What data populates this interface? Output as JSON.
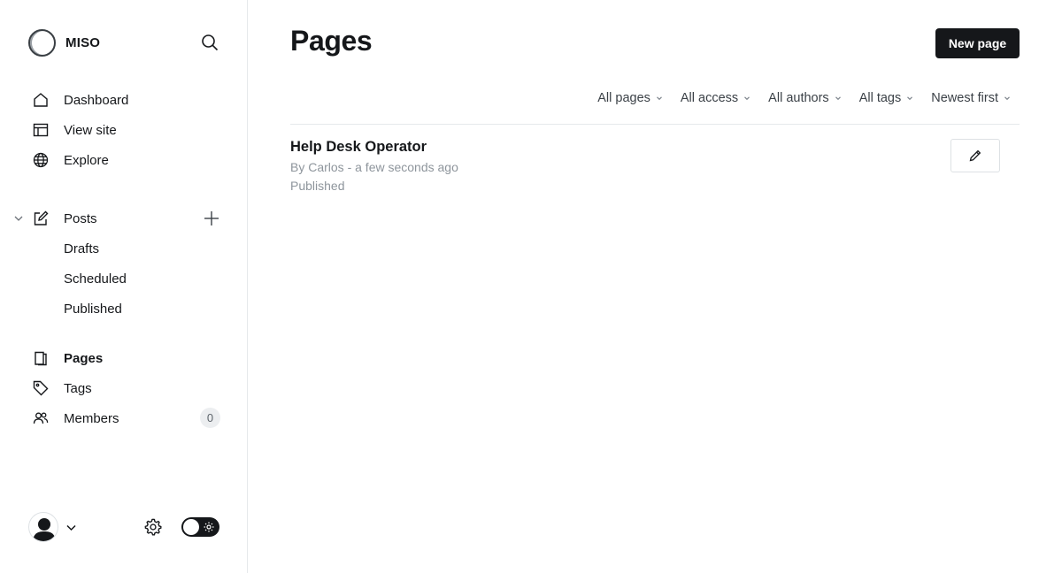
{
  "brand": {
    "name": "MISO"
  },
  "sidebar": {
    "nav": [
      {
        "label": "Dashboard",
        "icon": "home-icon"
      },
      {
        "label": "View site",
        "icon": "layout-icon"
      },
      {
        "label": "Explore",
        "icon": "globe-icon"
      }
    ],
    "posts": {
      "label": "Posts",
      "icon": "edit-icon",
      "subitems": [
        "Drafts",
        "Scheduled",
        "Published"
      ]
    },
    "sections": [
      {
        "label": "Pages",
        "icon": "page-icon",
        "active": true
      },
      {
        "label": "Tags",
        "icon": "tag-icon"
      },
      {
        "label": "Members",
        "icon": "members-icon",
        "badge": "0"
      }
    ]
  },
  "main": {
    "title": "Pages",
    "new_button_label": "New page",
    "filters": [
      "All pages",
      "All access",
      "All authors",
      "All tags",
      "Newest first"
    ],
    "rows": [
      {
        "title": "Help Desk Operator",
        "meta": "By Carlos - a few seconds ago",
        "status": "Published"
      }
    ]
  },
  "colors": {
    "accent": "#15171a",
    "muted": "#8e959c",
    "border": "#e6e9eb"
  }
}
